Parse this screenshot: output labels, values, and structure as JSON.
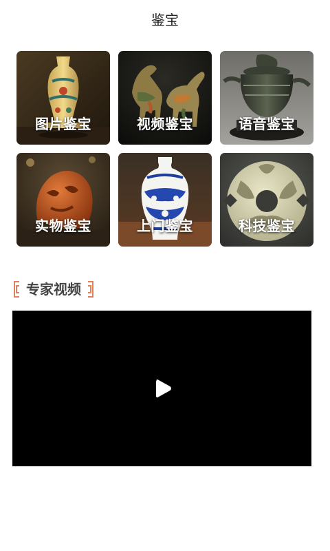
{
  "header": {
    "title": "鉴宝"
  },
  "tiles": [
    {
      "label": "图片鉴宝"
    },
    {
      "label": "视频鉴宝"
    },
    {
      "label": "语音鉴宝"
    },
    {
      "label": "实物鉴宝"
    },
    {
      "label": "上门鉴宝"
    },
    {
      "label": "科技鉴宝"
    }
  ],
  "section": {
    "title": "专家视频"
  },
  "icons": {
    "play": "play-icon",
    "bracket_left": "bracket-left-icon",
    "bracket_right": "bracket-right-icon"
  },
  "colors": {
    "accent": "#e0805a",
    "video_bg": "#000000",
    "title_text": "#444444"
  }
}
